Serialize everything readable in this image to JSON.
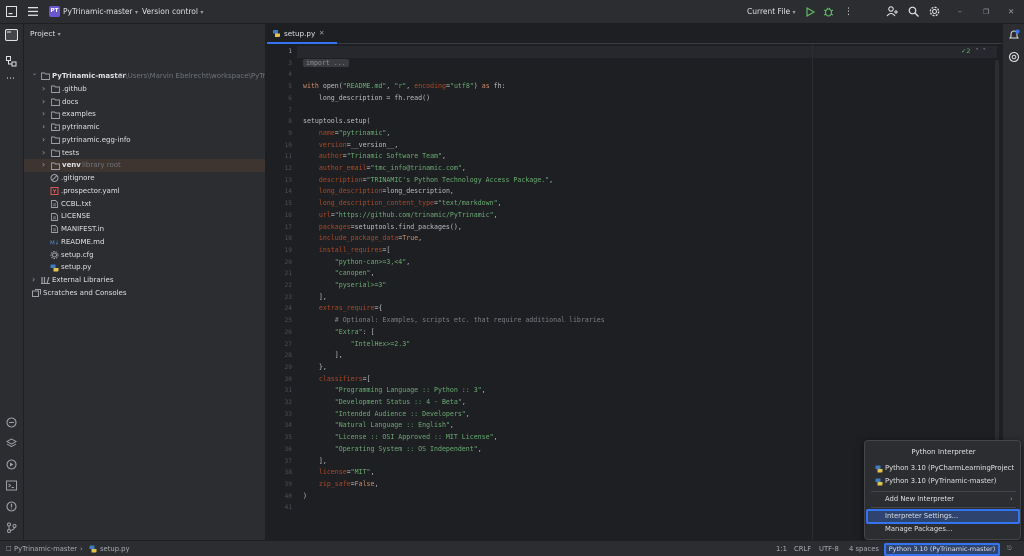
{
  "titlebar": {
    "project_initials": "PT",
    "project_name": "PyTrinamic-master",
    "vcs_label": "Version control",
    "run_config": "Current File"
  },
  "project_panel": {
    "title": "Project",
    "tree": [
      {
        "label": "PyTrinamic-master",
        "hint": "C:\\Users\\Marvin Ebelrecht\\workspace\\PyTri",
        "icon": "folder-icon",
        "expanded": true
      },
      {
        "label": ".github",
        "hint": "",
        "icon": "folder-icon"
      },
      {
        "label": "docs",
        "hint": "",
        "icon": "folder-icon"
      },
      {
        "label": "examples",
        "hint": "",
        "icon": "folder-icon"
      },
      {
        "label": "pytrinamic",
        "hint": "",
        "icon": "package-icon"
      },
      {
        "label": "pytrinamic.egg-info",
        "hint": "",
        "icon": "folder-icon"
      },
      {
        "label": "tests",
        "hint": "",
        "icon": "folder-icon"
      },
      {
        "label": "venv",
        "hint": "library root",
        "icon": "folder-icon"
      },
      {
        "label": ".gitignore",
        "hint": "",
        "icon": "gitignore-icon"
      },
      {
        "label": ".prospector.yaml",
        "hint": "",
        "icon": "yaml-icon"
      },
      {
        "label": "CCBL.txt",
        "hint": "",
        "icon": "text-file-icon"
      },
      {
        "label": "LICENSE",
        "hint": "",
        "icon": "text-file-icon"
      },
      {
        "label": "MANIFEST.in",
        "hint": "",
        "icon": "text-file-icon"
      },
      {
        "label": "README.md",
        "hint": "",
        "icon": "markdown-icon"
      },
      {
        "label": "setup.cfg",
        "hint": "",
        "icon": "config-file-icon"
      },
      {
        "label": "setup.py",
        "hint": "",
        "icon": "python-file-icon"
      },
      {
        "label": "External Libraries",
        "hint": "",
        "icon": "library-icon"
      },
      {
        "label": "Scratches and Consoles",
        "hint": "",
        "icon": "scratches-icon"
      }
    ]
  },
  "editor": {
    "tab_label": "setup.py",
    "inspection_count": "2",
    "line_numbers": [
      "1",
      "3",
      "4",
      "5",
      "6",
      "7",
      "8",
      "9",
      "10",
      "11",
      "12",
      "13",
      "14",
      "15",
      "16",
      "17",
      "18",
      "19",
      "20",
      "21",
      "22",
      "23",
      "24",
      "25",
      "26",
      "27",
      "28",
      "29",
      "30",
      "31",
      "32",
      "33",
      "34",
      "35",
      "36",
      "37",
      "38",
      "39",
      "40",
      "41"
    ]
  },
  "statusbar": {
    "breadcrumb_project": "PyTrinamic-master",
    "breadcrumb_file": "setup.py",
    "position": "1:1",
    "line_ending": "CRLF",
    "encoding": "UTF-8",
    "indent": "4 spaces",
    "interpreter": "Python 3.10 (PyTrinamic-master)"
  },
  "interpreter_popup": {
    "title": "Python Interpreter",
    "interpreters": [
      "Python 3.10 (PyCharmLearningProject",
      "Python 3.10 (PyTrinamic-master)"
    ],
    "add_new": "Add New Interpreter",
    "settings": "Interpreter Settings...",
    "manage_packages": "Manage Packages..."
  }
}
